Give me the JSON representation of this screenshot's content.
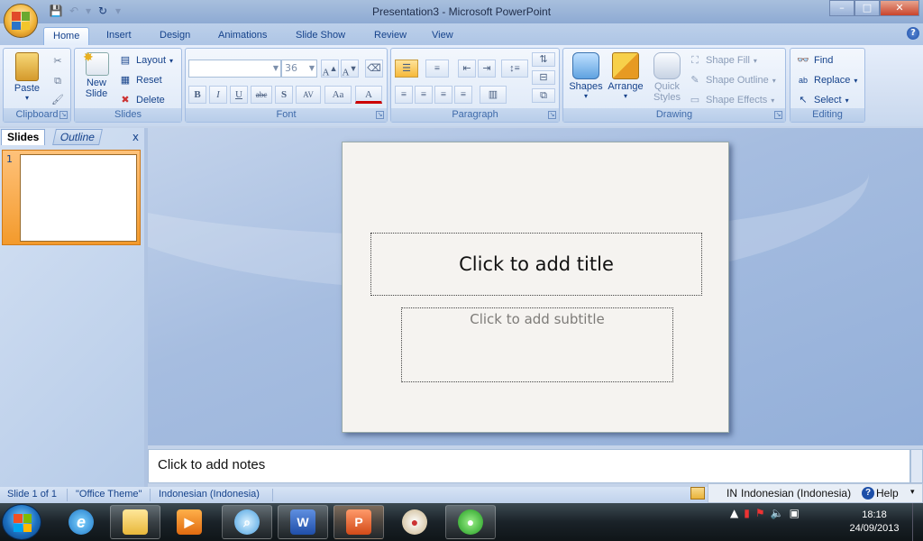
{
  "window": {
    "title": "Presentation3 - Microsoft PowerPoint",
    "faint_title": "",
    "controls": {
      "minimize": "–",
      "maximize": "□",
      "close": "✕"
    }
  },
  "quick_access": [
    "save-icon",
    "undo-icon",
    "redo-icon",
    "customize-icon"
  ],
  "tabs": [
    "Home",
    "Insert",
    "Design",
    "Animations",
    "Slide Show",
    "Review",
    "View"
  ],
  "active_tab": "Home",
  "ribbon": {
    "clipboard": {
      "label": "Clipboard",
      "paste": "Paste"
    },
    "slides": {
      "label": "Slides",
      "new_slide": "New Slide",
      "layout": "Layout",
      "reset": "Reset",
      "delete": "Delete"
    },
    "font": {
      "label": "Font",
      "font_name": "",
      "font_size": "36",
      "buttons": [
        "B",
        "I",
        "U",
        "abc",
        "S",
        "AV",
        "Aa",
        "A"
      ]
    },
    "paragraph": {
      "label": "Paragraph"
    },
    "drawing": {
      "label": "Drawing",
      "shapes": "Shapes",
      "arrange": "Arrange",
      "quick_styles": "Quick Styles",
      "shape_fill": "Shape Fill",
      "shape_outline": "Shape Outline",
      "shape_effects": "Shape Effects"
    },
    "editing": {
      "label": "Editing",
      "find": "Find",
      "replace": "Replace",
      "select": "Select"
    }
  },
  "left_panel": {
    "tab_slides": "Slides",
    "tab_outline": "Outline",
    "close": "x",
    "slide_number": "1"
  },
  "slide": {
    "title_placeholder": "Click to add title",
    "subtitle_placeholder": "Click to add subtitle"
  },
  "notes": {
    "placeholder": "Click to add notes"
  },
  "statusbar": {
    "slide_info": "Slide 1 of 1",
    "theme": "\"Office Theme\"",
    "language": "Indonesian (Indonesia)"
  },
  "langbar": {
    "code": "IN",
    "language": "Indonesian (Indonesia)",
    "help": "Help"
  },
  "taskbar": {
    "apps": [
      "windows-explorer",
      "internet-explorer",
      "media-player",
      "search",
      "word",
      "powerpoint",
      "paint",
      "app-green"
    ],
    "time": "18:18",
    "date": "24/09/2013"
  },
  "colors": {
    "ribbon_text": "#15428b",
    "accent_orange": "#f39a2c",
    "taskbar": "#1a2228"
  }
}
